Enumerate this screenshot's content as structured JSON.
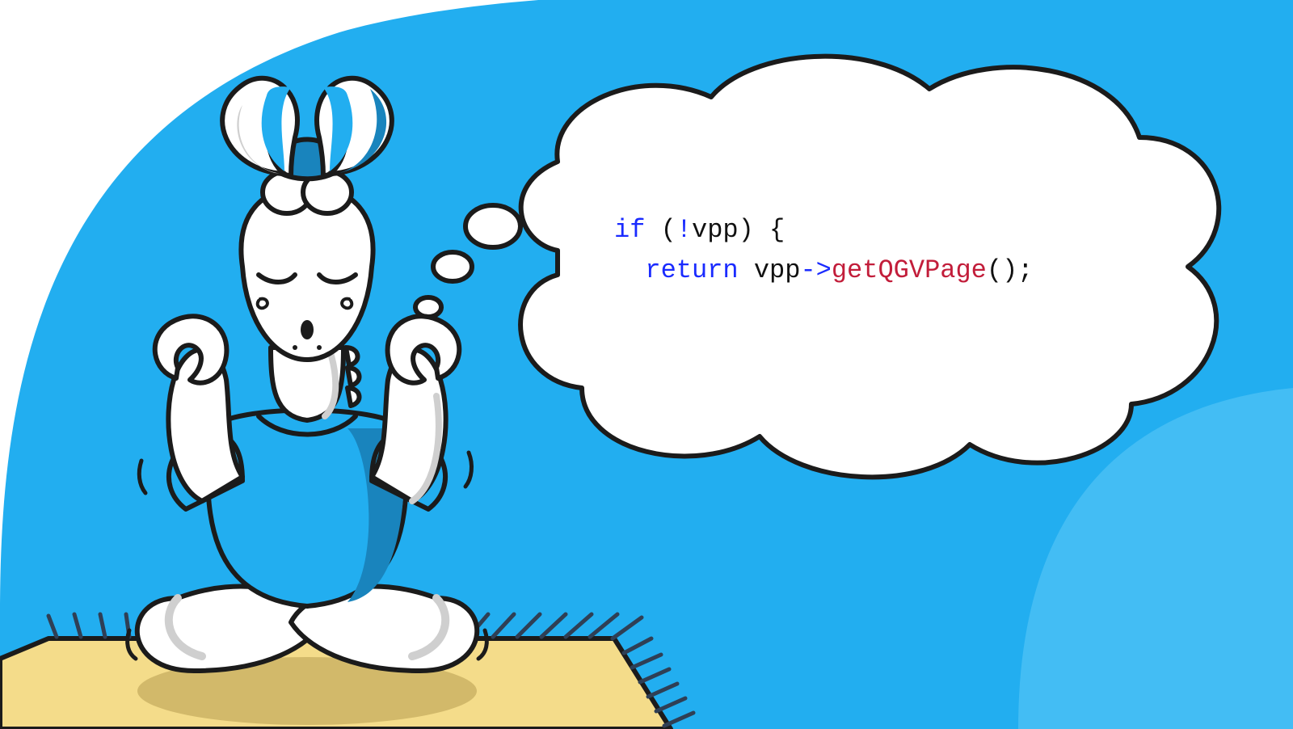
{
  "colors": {
    "bg_blue": "#22aef0",
    "bg_blue_inner": "#43bdf4",
    "rug_fill": "#f4dc8a",
    "rug_edge": "#1b1b1b",
    "rug_fringe": "#2f3f55",
    "shadow": "#d2b96a",
    "stroke": "#1b1b1b",
    "body_fill": "#ffffff",
    "body_shade": "#e6e6e6",
    "shirt": "#22aef0",
    "shirt_shade": "#1984bd",
    "horn_blue": "#1984bd",
    "horn_blue_light": "#22aef0",
    "bubble_fill": "#ffffff",
    "code_keyword": "#1a2bff",
    "code_default": "#111111",
    "code_func": "#c21d3a"
  },
  "code": {
    "line1_if": "if",
    "line1_rest": " (",
    "line1_bang": "!",
    "line1_var": "vpp) {",
    "line2_indent": "  ",
    "line2_return": "return",
    "line2_mid": " vpp",
    "line2_arrow": "->",
    "line2_func": "getQGVPage",
    "line2_end": "();"
  }
}
